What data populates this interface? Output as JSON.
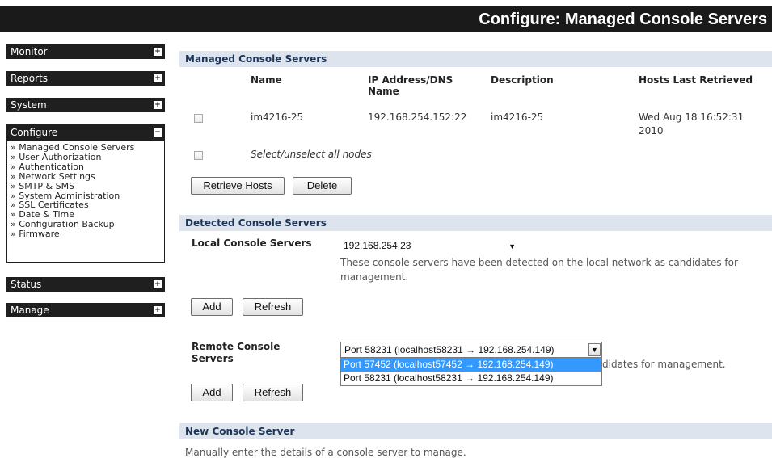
{
  "header": {
    "title": "Configure: Managed Console Servers"
  },
  "sidebar": {
    "monitor": "Monitor",
    "reports": "Reports",
    "system": "System",
    "configure": "Configure",
    "configure_items": [
      "» Managed Console Servers",
      "» User Authorization",
      "» Authentication",
      "» Network Settings",
      "» SMTP & SMS",
      "» System Administration",
      "» SSL Certificates",
      "» Date & Time",
      "» Configuration Backup",
      "» Firmware"
    ],
    "status": "Status",
    "manage": "Manage",
    "expand_glyph": "+",
    "collapse_glyph": "−"
  },
  "managed": {
    "title": "Managed Console Servers",
    "columns": [
      "Name",
      "IP Address/DNS Name",
      "Description",
      "Hosts Last Retrieved"
    ],
    "row": {
      "name": "im4216-25",
      "ip": "192.168.254.152:22",
      "description": "im4216-25",
      "retrieved_line1": "Wed Aug 18 16:52:31",
      "retrieved_line2": "2010"
    },
    "select_all": "Select/unselect all nodes",
    "retrieve_button": "Retrieve Hosts",
    "delete_button": "Delete"
  },
  "detected": {
    "title": "Detected Console Servers",
    "local_label": "Local Console Servers",
    "local_selected": "192.168.254.23",
    "local_note_line1": "These console servers have been detected on the local network as candidates for",
    "local_note_line2": "management.",
    "add_button": "Add",
    "refresh_button": "Refresh",
    "remote_label_line1": "Remote Console",
    "remote_label_line2": "Servers",
    "remote_selected": "Port 58231 (localhost58231 → 192.168.254.149)",
    "remote_options": [
      "Port 57452 (localhost57452 → 192.168.254.149)",
      "Port 58231 (localhost58231 → 192.168.254.149)"
    ],
    "remote_note_partial": "didates for management.",
    "add_button_2": "Add",
    "refresh_button_2": "Refresh"
  },
  "new_server": {
    "title": "New Console Server",
    "note": "Manually enter the details of a console server to manage."
  },
  "icons": {
    "dropdown": "chevron-down-icon"
  },
  "colors": {
    "section_bg": "#dde4ee",
    "section_text": "#1d3557",
    "highlight": "#3399ff",
    "dark_bar": "#1a1a1a"
  }
}
